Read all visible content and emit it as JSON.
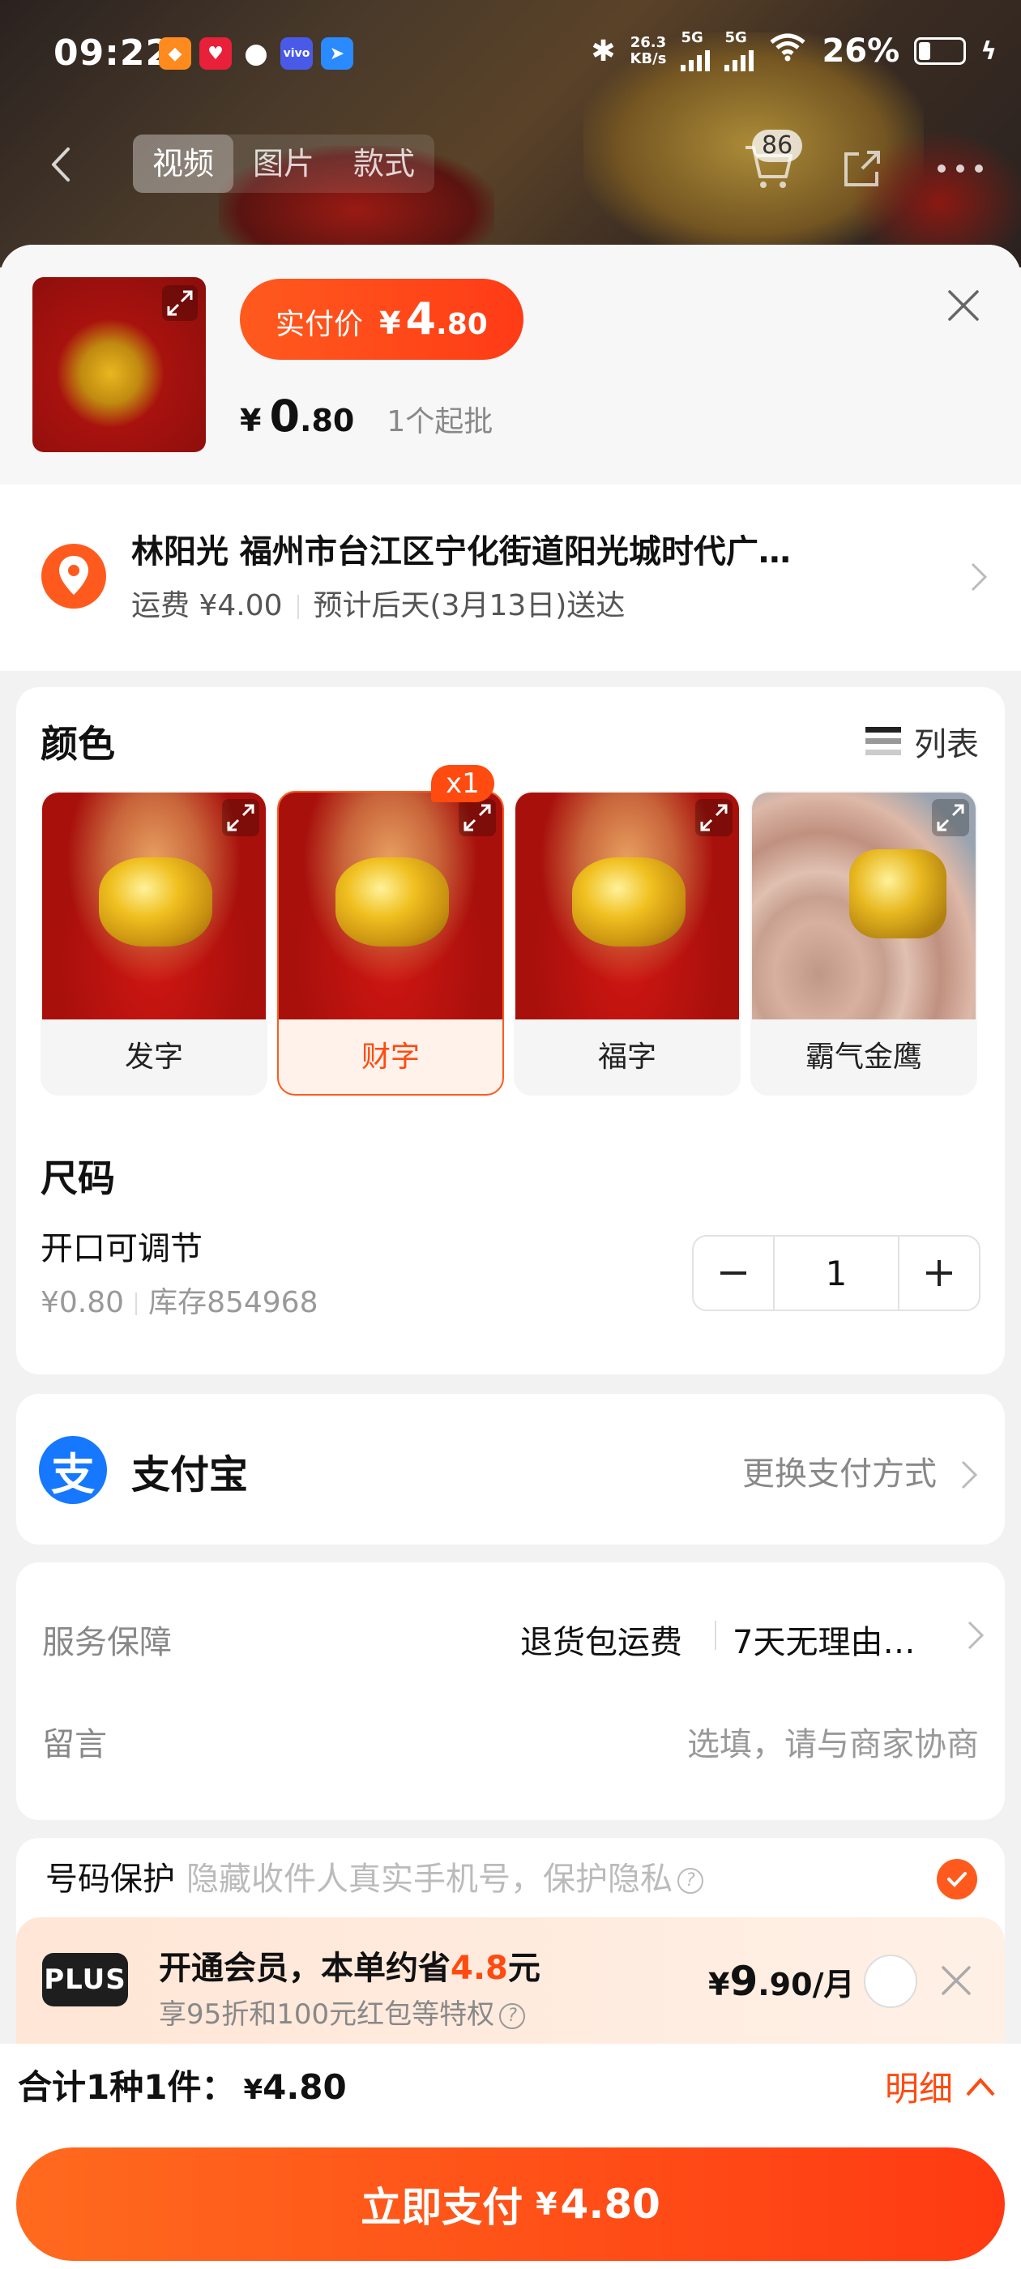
{
  "status": {
    "time": "09:22",
    "net_speed": "26.3",
    "net_unit": "KB/s",
    "sig1": "5G",
    "sig2": "5G",
    "battery": "26%"
  },
  "nav": {
    "tabs": [
      "视频",
      "图片",
      "款式"
    ],
    "cart_count": "86"
  },
  "product": {
    "pay_label": "实付价",
    "pay_currency": "¥",
    "pay_int": "4",
    "pay_dec": ".80",
    "unit_currency": "¥",
    "unit_int": "0",
    "unit_dec": ".80",
    "moq": "1个起批"
  },
  "address": {
    "line": "林阳光 福州市台江区宁化街道阳光城时代广…",
    "shipping": "运费 ¥4.00",
    "eta": "预计后天(3月13日)送达"
  },
  "color": {
    "title": "颜色",
    "list_label": "列表",
    "selected_badge": "x1",
    "options": [
      {
        "label": "发字"
      },
      {
        "label": "财字"
      },
      {
        "label": "福字"
      },
      {
        "label": "霸气金鹰"
      }
    ]
  },
  "size": {
    "title": "尺码",
    "name": "开口可调节",
    "price": "¥0.80",
    "stock": "库存854968",
    "qty": "1"
  },
  "payment": {
    "icon_text": "支",
    "method": "支付宝",
    "change": "更换支付方式"
  },
  "service": {
    "label": "服务保障",
    "v1": "退货包运费",
    "v2": "7天无理由…",
    "msg_label": "留言",
    "msg_placeholder": "选填，请与商家协商"
  },
  "privacy": {
    "label": "号码保护",
    "desc": "隐藏收件人真实手机号，保护隐私",
    "checked": true
  },
  "plus": {
    "badge": "PLUS",
    "title_pre": "开通会员，本单约省",
    "save": "4.8",
    "title_post": "元",
    "sub": "享95折和100元红包等特权",
    "price_cur": "¥",
    "price_int": "9",
    "price_rest": ".90/月"
  },
  "footer": {
    "total_label": "合计1种1件：",
    "total_cur": "¥",
    "total": "4.80",
    "detail": "明细",
    "pay_label": "立即支付",
    "pay_cur": "¥",
    "pay_amount": "4.80"
  },
  "colors": {
    "accent": "#ff4a10",
    "alipay": "#1677ff"
  }
}
